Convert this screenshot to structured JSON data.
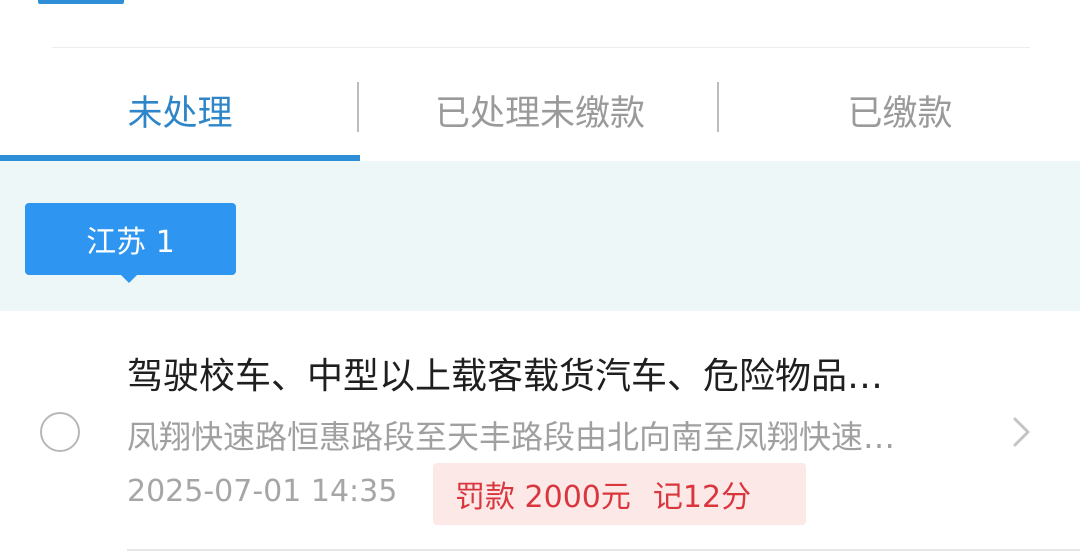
{
  "tabs": [
    {
      "label": "未处理",
      "active": true
    },
    {
      "label": "已处理未缴款",
      "active": false
    },
    {
      "label": "已缴款",
      "active": false
    }
  ],
  "region_chip": {
    "label": "江苏 1"
  },
  "records": [
    {
      "title": "驾驶校车、中型以上载客载货汽车、危险物品…",
      "location": "凤翔快速路恒惠路段至天丰路段由北向南至凤翔快速…",
      "time": "2025-07-01 14:35",
      "fine": "罚款 2000元",
      "points": "记12分"
    }
  ],
  "colors": {
    "accent": "#2e8fd6",
    "chip": "#2e95f0",
    "penalty_text": "#d9363e",
    "penalty_bg": "#fde8e8",
    "band": "#eef7f7"
  },
  "icons": {
    "record_select": "radio-circle-icon",
    "record_open": "chevron-right-icon"
  }
}
